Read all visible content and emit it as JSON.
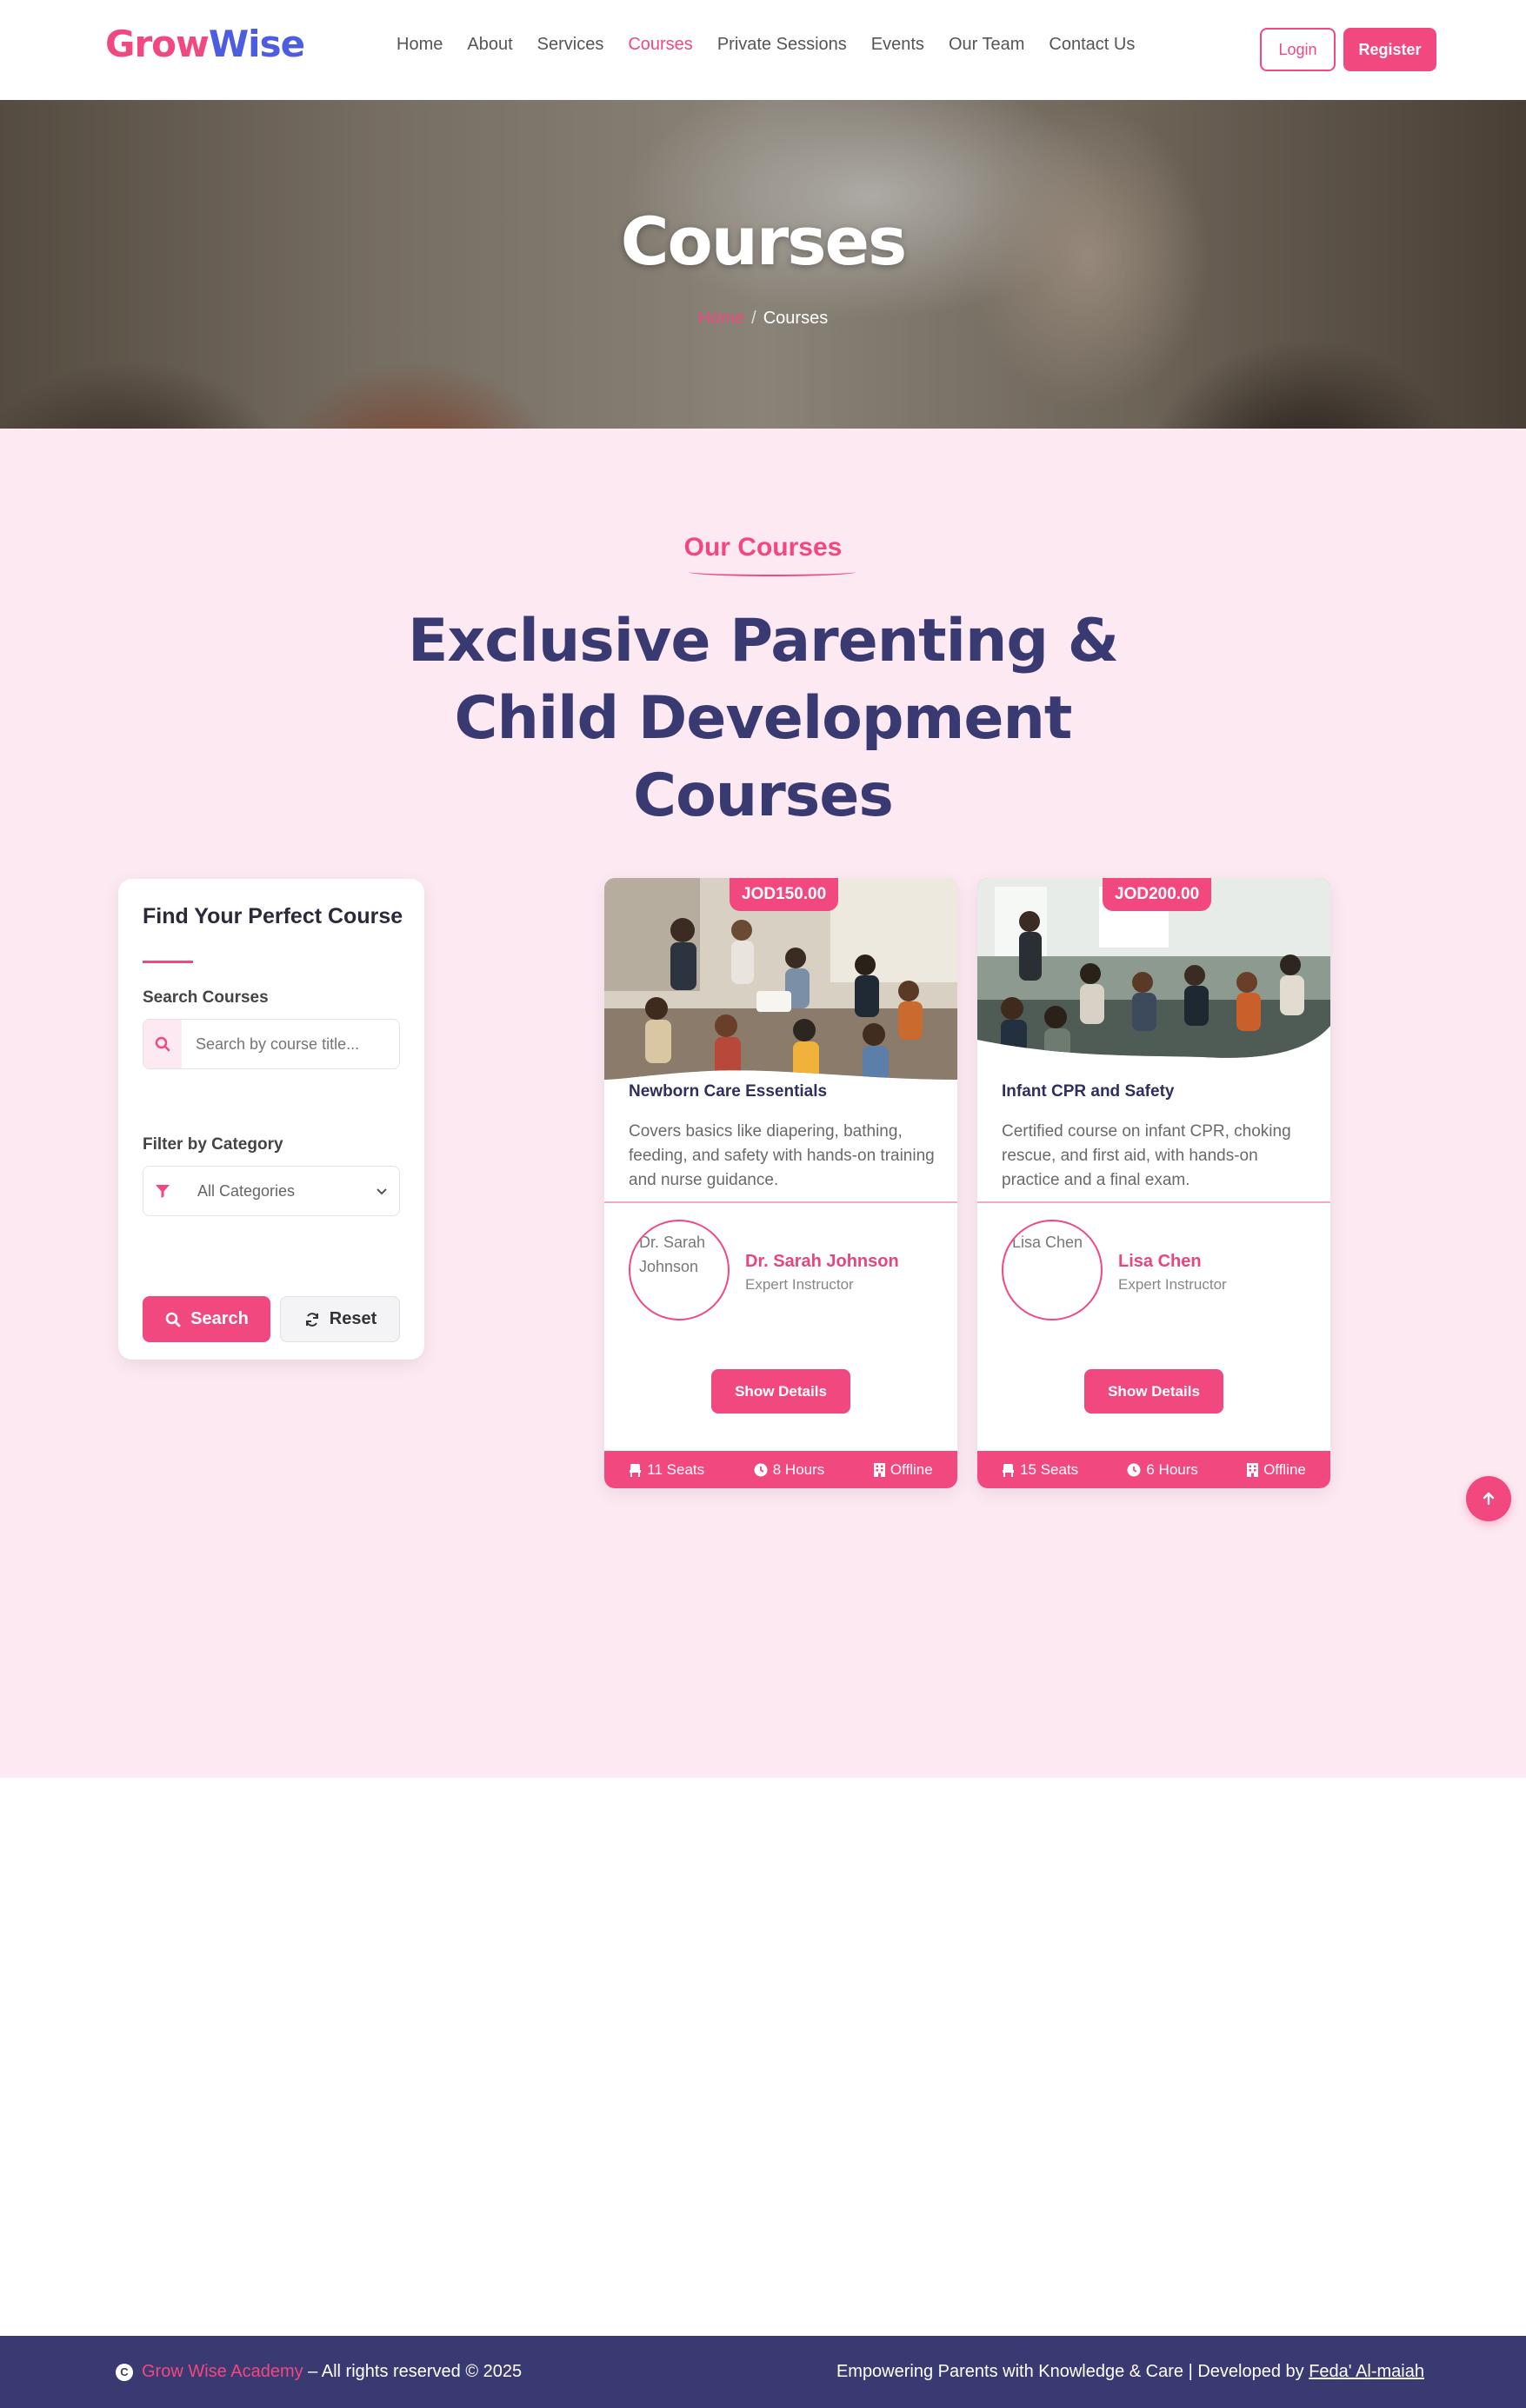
{
  "brand": {
    "part1": "Grow",
    "part2": "Wise"
  },
  "nav": {
    "items": [
      {
        "label": "Home"
      },
      {
        "label": "About"
      },
      {
        "label": "Services"
      },
      {
        "label": "Courses"
      },
      {
        "label": "Private Sessions"
      },
      {
        "label": "Events"
      },
      {
        "label": "Our Team"
      },
      {
        "label": "Contact Us"
      }
    ],
    "active": "Courses",
    "login_label": "Login",
    "register_label": "Register"
  },
  "hero": {
    "title": "Courses",
    "breadcrumb_home": "Home",
    "breadcrumb_separator": "/",
    "breadcrumb_current": "Courses"
  },
  "section": {
    "subtitle": "Our Courses",
    "heading": "Exclusive Parenting & Child Development Courses"
  },
  "filter": {
    "title": "Find Your Perfect Course",
    "search_label": "Search Courses",
    "search_placeholder": "Search by course title...",
    "search_value": "",
    "category_label": "Filter by Category",
    "category_value": "All Categories",
    "search_button": "Search",
    "reset_button": "Reset"
  },
  "courses": [
    {
      "price": "JOD150.00",
      "title": "Newborn Care Essentials",
      "description": "Covers basics like diapering, bathing, feeding, and safety with hands-on training and nurse guidance.",
      "avatar_alt": "Dr. Sarah Johnson",
      "instructor": "Dr. Sarah Johnson",
      "role": "Expert Instructor",
      "details_button": "Show Details",
      "seats": "11 Seats",
      "hours": "8 Hours",
      "mode": "Offline"
    },
    {
      "price": "JOD200.00",
      "title": "Infant CPR and Safety",
      "description": "Certified course on infant CPR, choking rescue, and first aid, with hands-on practice and a final exam.",
      "avatar_alt": "Lisa Chen",
      "instructor": "Lisa Chen",
      "role": "Expert Instructor",
      "details_button": "Show Details",
      "seats": "15 Seats",
      "hours": "6 Hours",
      "mode": "Offline"
    }
  ],
  "footer": {
    "brand_link": "Grow Wise Academy",
    "rights": "– All rights reserved © 2025",
    "tagline": "Empowering Parents with Knowledge & Care | Developed by",
    "developer": "Feda' Al-maiah"
  },
  "colors": {
    "accent": "#f0487f",
    "brand_blue": "#4d5de0",
    "navy": "#3a3a72",
    "section_bg": "#fde9f1"
  }
}
